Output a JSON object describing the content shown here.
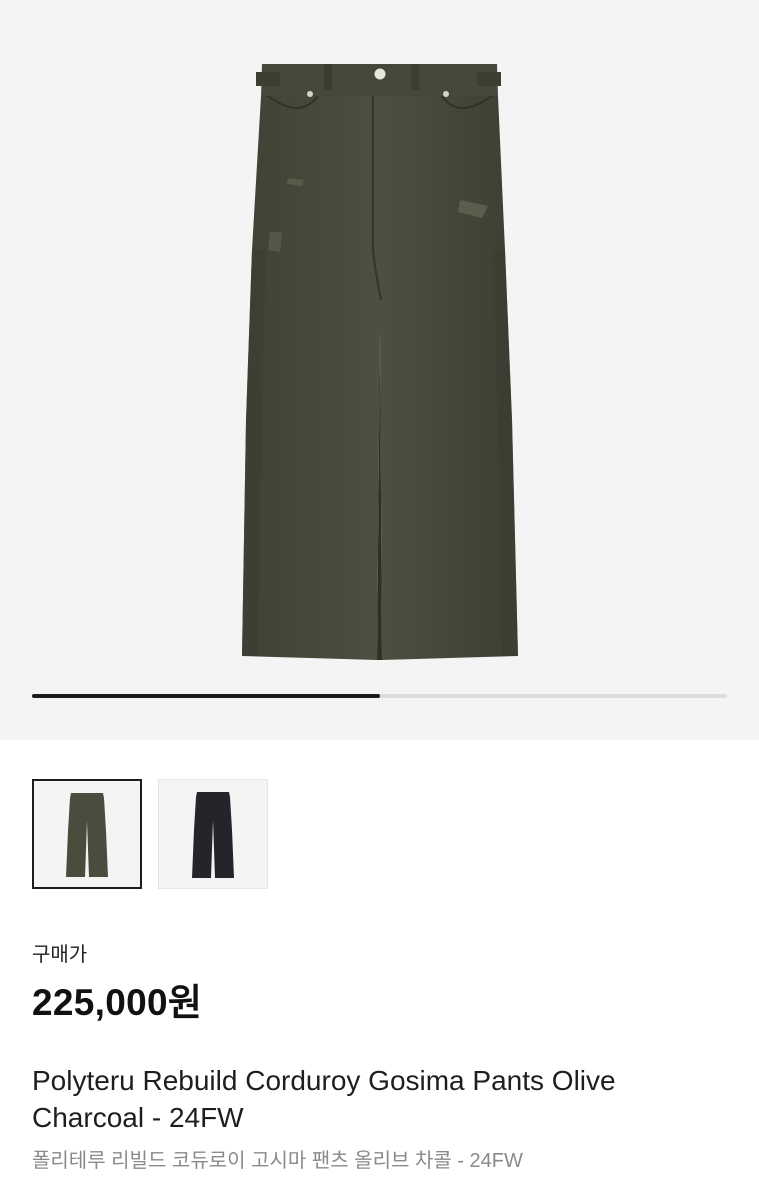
{
  "product": {
    "image_name": "olive-charcoal-pants-image",
    "gallery_progress": 0.5,
    "thumbnails": [
      {
        "name": "thumbnail-olive",
        "color": "#4a4d3e",
        "selected": true
      },
      {
        "name": "thumbnail-black",
        "color": "#23252a",
        "selected": false
      }
    ],
    "price_label": "구매가",
    "price": "225,000원",
    "title": "Polyteru Rebuild Corduroy Gosima Pants Olive Charcoal - 24FW",
    "subtitle": "폴리테루 리빌드 코듀로이 고시마 팬츠 올리브 차콜 - 24FW"
  },
  "colors": {
    "background": "#f4f4f4",
    "pants_olive": "#4a4d3e",
    "pants_black": "#23252a",
    "progress_fill": "#1c1c1c",
    "subtitle_text": "#8a8a8a"
  }
}
